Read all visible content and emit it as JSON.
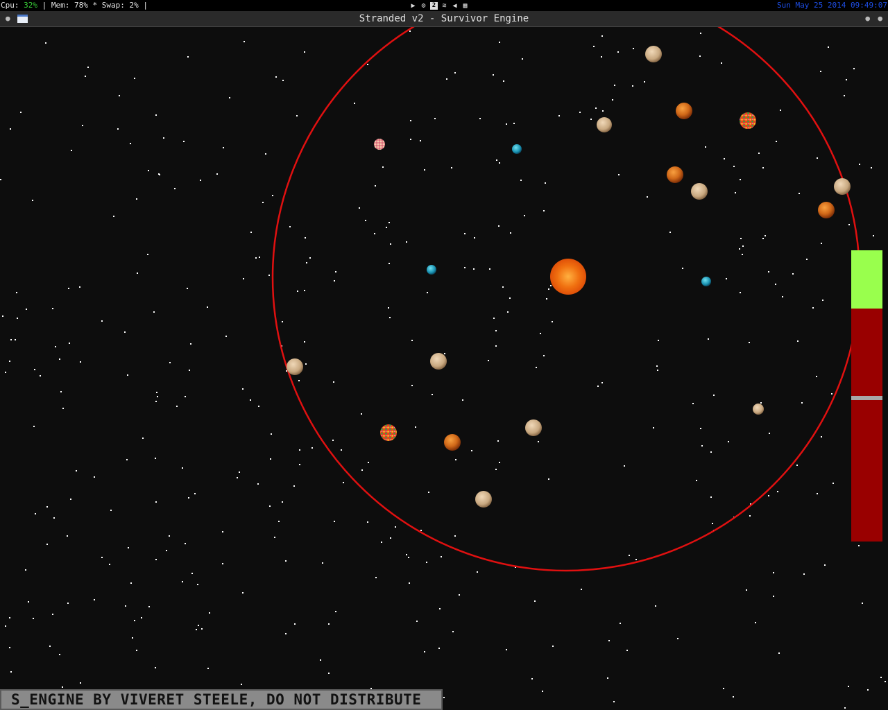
{
  "statusbar": {
    "cpu_label": "Cpu: ",
    "cpu_value": "32%",
    "rest": " | Mem: 78% * Swap: 2% |",
    "workspace": "2",
    "clock": "Sun May 25 2014 09:49:07"
  },
  "window": {
    "title": "Stranded v2 - Survivor Engine"
  },
  "hud": {
    "bar_fill_fraction": 0.2,
    "bar_marker_fraction": 0.5
  },
  "colors": {
    "boundary_ring": "#e01010",
    "sun": "#f07010",
    "bar_good": "#99ff4d",
    "bar_bad": "#990000"
  },
  "watermark": "S_ENGINE BY VIVERET STEELE, DO NOT DISTRIBUTE"
}
